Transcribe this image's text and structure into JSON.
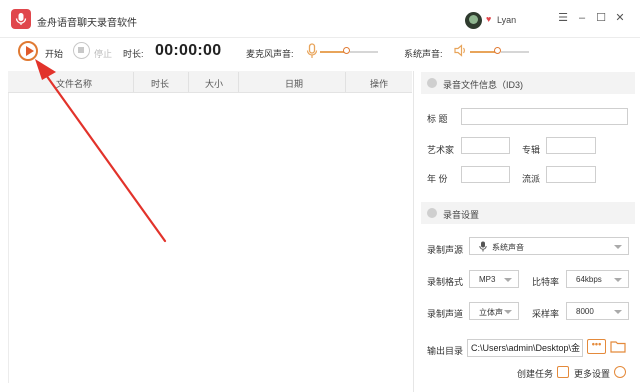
{
  "app": {
    "title": "金舟语音聊天录音软件",
    "username": "Lyan"
  },
  "window_controls": {
    "menu": "☰",
    "minimize": "–",
    "maximize": "☐",
    "close": "✕"
  },
  "toolbar": {
    "start_label": "开始",
    "stop_label": "停止",
    "duration_label": "时长:",
    "timer": "00:00:00",
    "mic_label": "麦克风声音:",
    "system_label": "系统声音:"
  },
  "table": {
    "columns": [
      "文件名称",
      "时长",
      "大小",
      "日期",
      "操作"
    ],
    "rows": []
  },
  "id3": {
    "title": "录音文件信息（ID3)",
    "title_label": "标  题",
    "artist_label": "艺术家",
    "album_label": "专辑",
    "year_label": "年  份",
    "genre_label": "流派"
  },
  "settings": {
    "title": "录音设置",
    "source_label": "录制声源",
    "source_value": "系统声音",
    "format_label": "录制格式",
    "format_value": "MP3",
    "bitrate_label": "比特率",
    "bitrate_value": "64kbps",
    "channel_label": "录制声道",
    "channel_value": "立体声",
    "samplerate_label": "采样率",
    "samplerate_value": "8000",
    "output_label": "输出目录",
    "output_path": "C:\\Users\\admin\\Desktop\\金",
    "dots_label": "•••",
    "create_task": "创建任务",
    "more_settings": "更多设置"
  },
  "colors": {
    "accent": "#e07a33",
    "brand": "#e0474c",
    "arrow": "#e2332b"
  }
}
